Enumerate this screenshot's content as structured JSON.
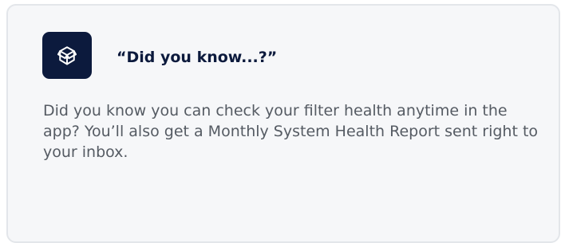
{
  "card": {
    "title": "“Did you know...?”",
    "body": "Did you know you can check your filter health anytime in the app? You’ll also get a Monthly System Health Report sent right to your inbox.",
    "icon": "package-box-icon",
    "colors": {
      "icon_background": "#0c1a3d",
      "title": "#0c1a3d",
      "body": "#555b63",
      "card_background": "#f6f7f9",
      "card_border": "#e3e6ea"
    }
  }
}
